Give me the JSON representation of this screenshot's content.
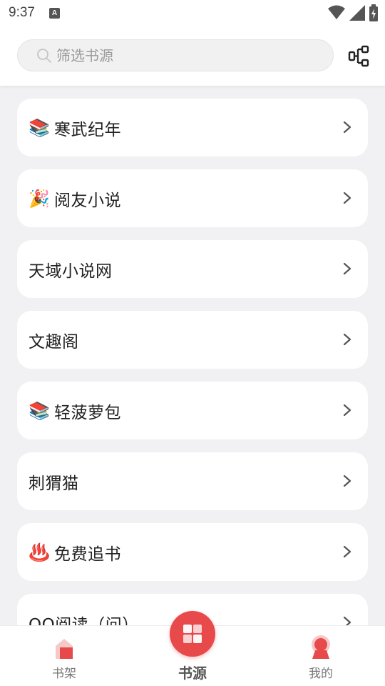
{
  "status_bar": {
    "time": "9:37",
    "notification_icon": "A",
    "icons": [
      "wifi-icon",
      "signal-icon",
      "battery-charging-icon"
    ]
  },
  "search": {
    "placeholder": "筛选书源",
    "value": ""
  },
  "header_action_icon": "flow-diagram-icon",
  "sources": [
    {
      "emoji": "📚",
      "label": "寒武纪年"
    },
    {
      "emoji": "🎉",
      "label": "阅友小说"
    },
    {
      "emoji": "",
      "label": "天域小说网"
    },
    {
      "emoji": "",
      "label": "文趣阁"
    },
    {
      "emoji": "📚",
      "label": "轻菠萝包"
    },
    {
      "emoji": "",
      "label": "刺猬猫"
    },
    {
      "emoji": "♨️",
      "label": "免费追书"
    },
    {
      "emoji": "",
      "label": "QQ阅读（问）"
    }
  ],
  "tabs": [
    {
      "label": "书架",
      "icon": "bookshelf-icon"
    },
    {
      "label": "书源",
      "icon": "book-source-icon",
      "active": true
    },
    {
      "label": "我的",
      "icon": "profile-badge-icon"
    }
  ],
  "colors": {
    "accent": "#e84a4c",
    "background": "#f1f1f3",
    "card": "#ffffff"
  }
}
